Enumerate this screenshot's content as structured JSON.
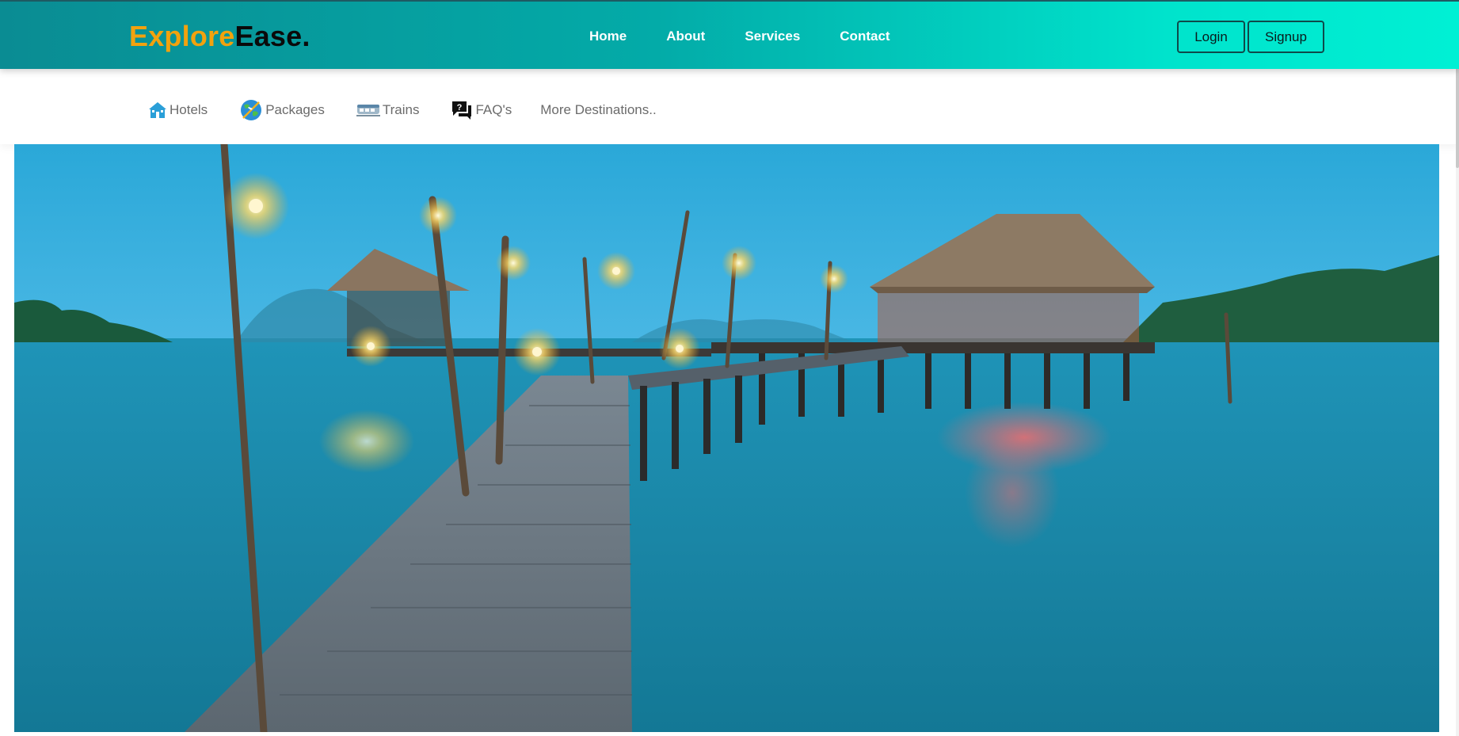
{
  "brand": {
    "part1": "Explore",
    "part2": "Ease."
  },
  "nav": {
    "home": "Home",
    "about": "About",
    "services": "Services",
    "contact": "Contact"
  },
  "auth": {
    "login": "Login",
    "signup": "Signup"
  },
  "subnav": {
    "hotels": {
      "label": "Hotels",
      "icon": "hotel-icon"
    },
    "packages": {
      "label": "Packages",
      "icon": "globe-plane-icon"
    },
    "trains": {
      "label": "Trains",
      "icon": "train-icon"
    },
    "faqs": {
      "label": "FAQ's",
      "icon": "faq-chat-icon"
    },
    "more": {
      "label": "More Destinations.."
    }
  },
  "hero": {
    "image": "tropical-pier-at-dusk"
  },
  "colors": {
    "brand_orange": "#f2a20e",
    "teal_start": "#0a8c93",
    "teal_end": "#00f0d4"
  }
}
